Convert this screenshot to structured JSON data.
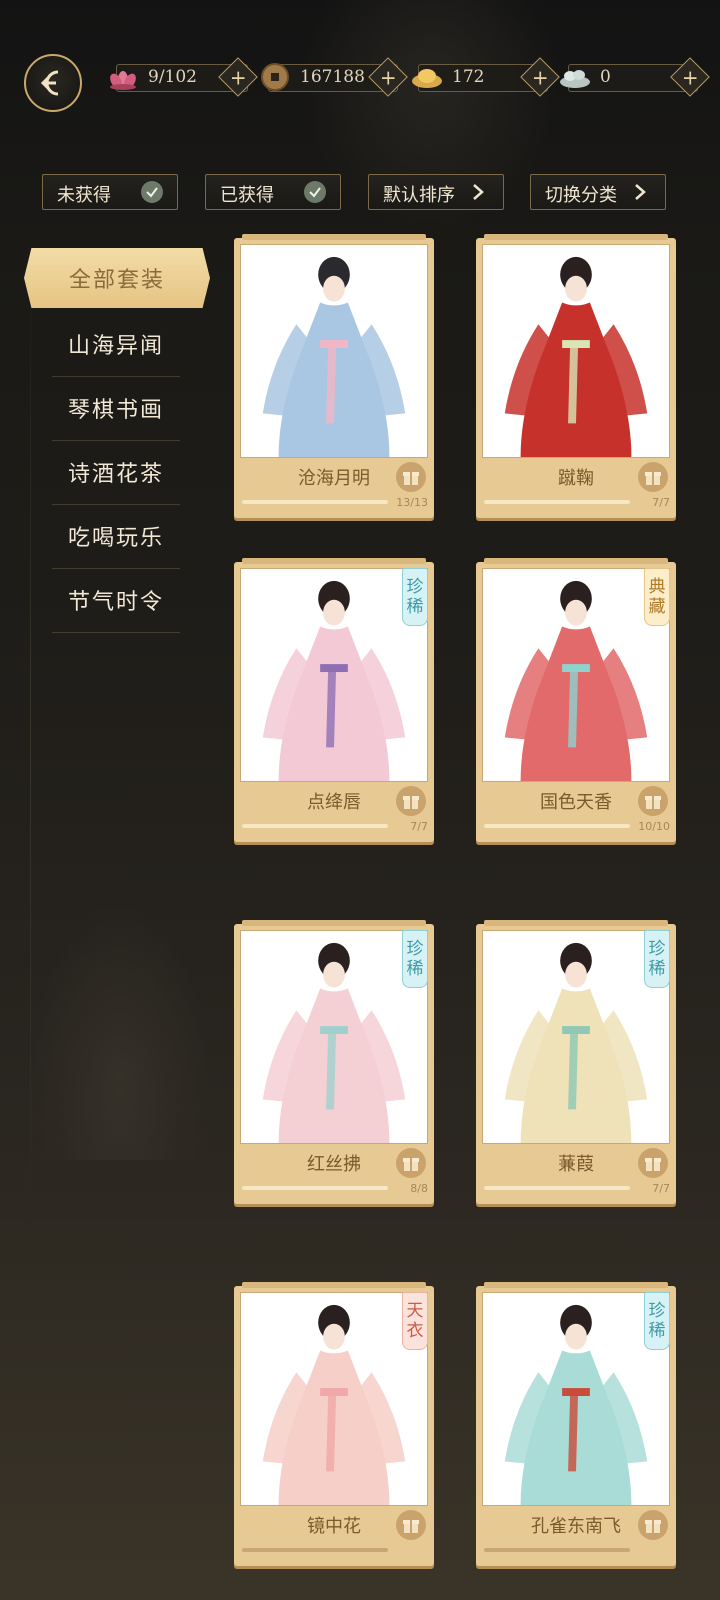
{
  "resources": [
    {
      "icon": "lotus-icon",
      "value": "9/102"
    },
    {
      "icon": "coin-icon",
      "value": "167188"
    },
    {
      "icon": "gold-ingot-icon",
      "value": "172"
    },
    {
      "icon": "silver-ingot-icon",
      "value": "0"
    }
  ],
  "filters": [
    {
      "label": "未获得",
      "kind": "check"
    },
    {
      "label": "已获得",
      "kind": "check"
    },
    {
      "label": "默认排序",
      "kind": "chevron"
    },
    {
      "label": "切换分类",
      "kind": "chevron"
    }
  ],
  "categories": {
    "active": "全部套装",
    "items": [
      "山海异闻",
      "琴棋书画",
      "诗酒花茶",
      "吃喝玩乐",
      "节气时令"
    ]
  },
  "cards": [
    {
      "name": "沧海月明",
      "count": "13/13",
      "progress": 1.0,
      "tag": "",
      "dress": "#a9c7e3",
      "accent": "#f2b6c4",
      "hair": "#2a2a2e"
    },
    {
      "name": "蹴鞠",
      "count": "7/7",
      "progress": 1.0,
      "tag": "",
      "dress": "#c7312c",
      "accent": "#d8e6b5",
      "hair": "#2a2020"
    },
    {
      "name": "点绛唇",
      "count": "7/7",
      "progress": 1.0,
      "tag": "珍稀",
      "tag_style": "rare",
      "dress": "#f3c9d6",
      "accent": "#8e6fb4",
      "hair": "#2a2020"
    },
    {
      "name": "国色天香",
      "count": "10/10",
      "progress": 1.0,
      "tag": "典藏",
      "tag_style": "collect",
      "dress": "#e26a6a",
      "accent": "#8fd3cf",
      "hair": "#2a2020"
    },
    {
      "name": "红丝拂",
      "count": "8/8",
      "progress": 1.0,
      "tag": "珍稀",
      "tag_style": "rare",
      "dress": "#f4cfd3",
      "accent": "#9fd1cc",
      "hair": "#2a2020"
    },
    {
      "name": "蒹葭",
      "count": "7/7",
      "progress": 1.0,
      "tag": "珍稀",
      "tag_style": "rare",
      "dress": "#efe2b8",
      "accent": "#8fc8b4",
      "hair": "#2a2020"
    },
    {
      "name": "镜中花",
      "count": "",
      "progress": 0,
      "tag": "天衣",
      "tag_style": "sky",
      "dress": "#f6cfc8",
      "accent": "#f0a8a8",
      "hair": "#2a2020"
    },
    {
      "name": "孔雀东南飞",
      "count": "",
      "progress": 0,
      "tag": "珍稀",
      "tag_style": "rare",
      "dress": "#a9dcd6",
      "accent": "#c94b3a",
      "hair": "#2a2020"
    }
  ]
}
